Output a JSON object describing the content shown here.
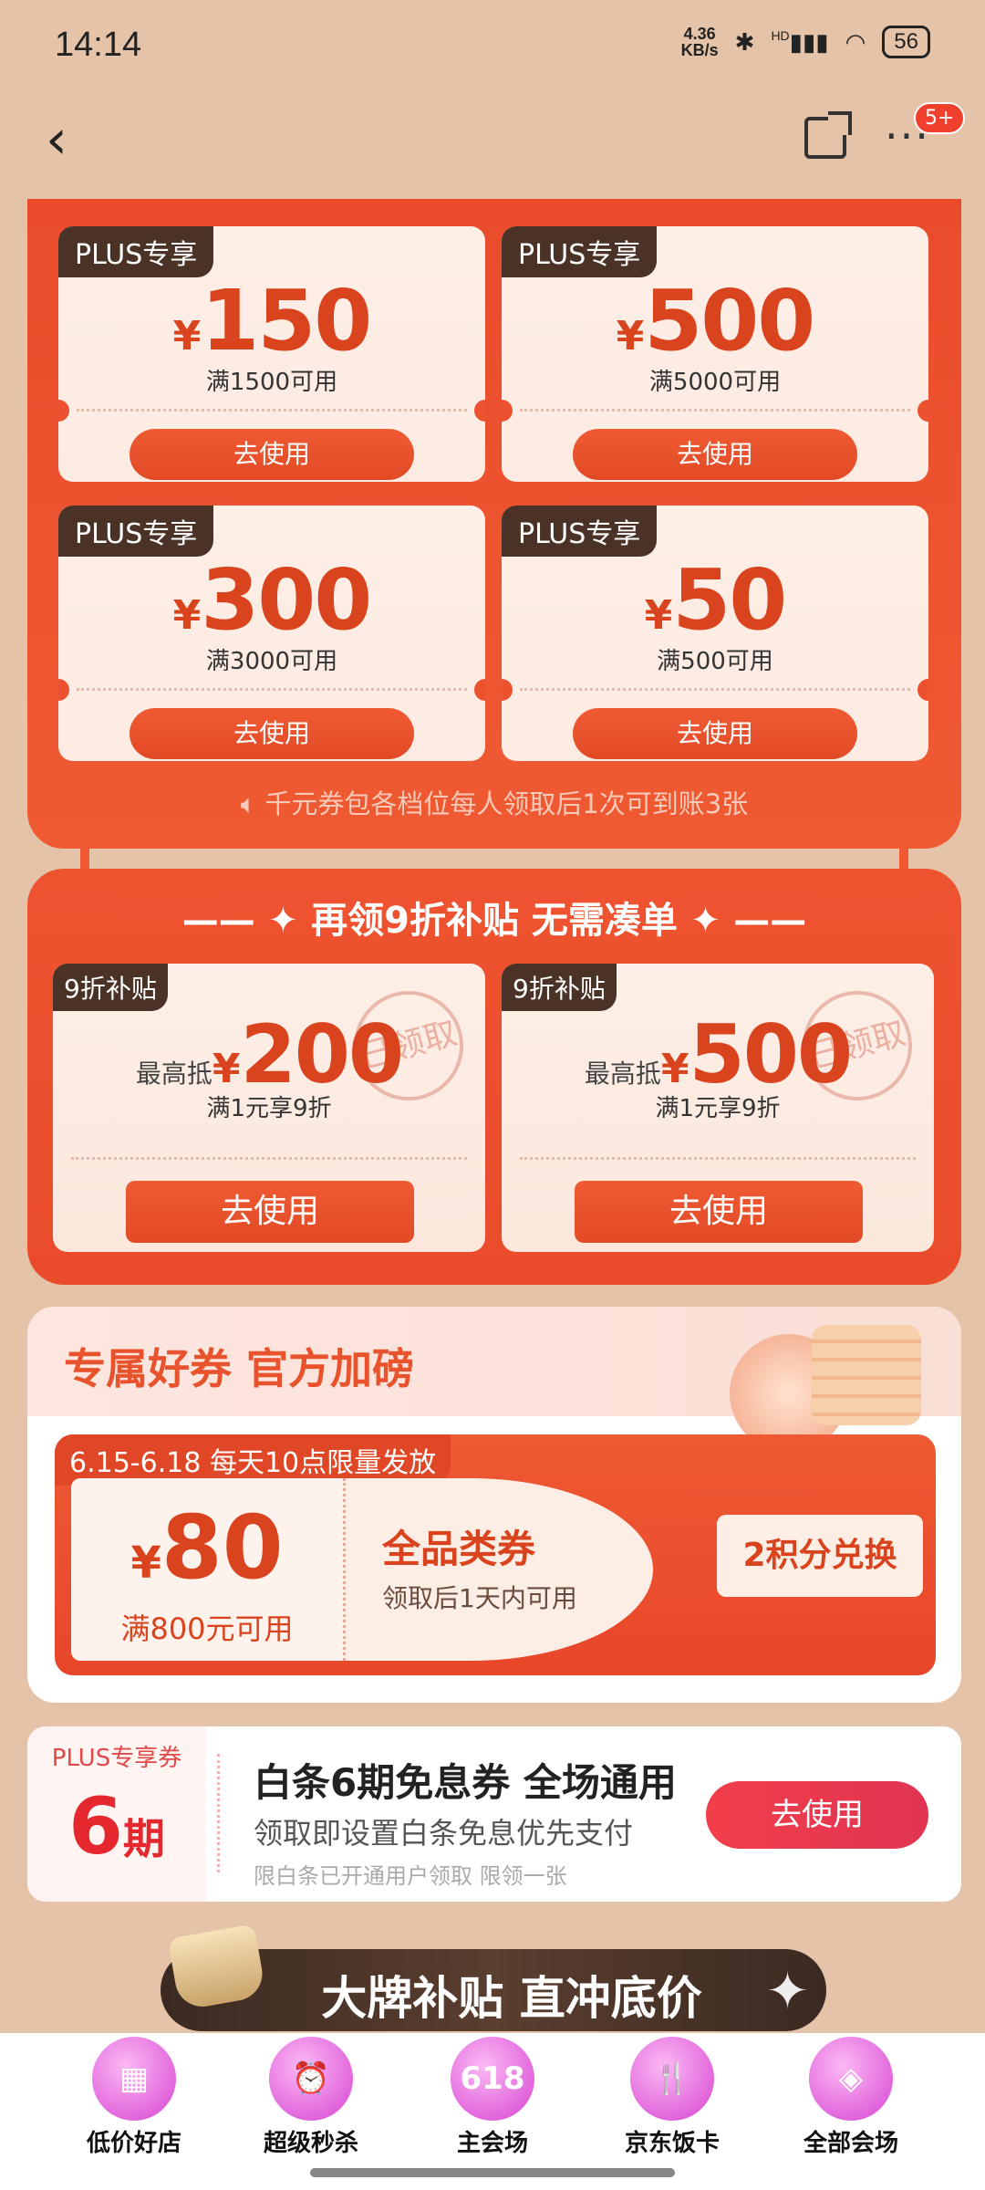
{
  "status_bar": {
    "time": "14:14",
    "net_speed_value": "4.36",
    "net_speed_unit": "KB/s",
    "signal": "HD",
    "battery": "56"
  },
  "nav": {
    "badge": "5+"
  },
  "plus_coupons": [
    {
      "tag": "PLUS专享",
      "yen": "¥",
      "amount": "150",
      "condition": "满1500可用",
      "button": "去使用"
    },
    {
      "tag": "PLUS专享",
      "yen": "¥",
      "amount": "500",
      "condition": "满5000可用",
      "button": "去使用"
    },
    {
      "tag": "PLUS专享",
      "yen": "¥",
      "amount": "300",
      "condition": "满3000可用",
      "button": "去使用"
    },
    {
      "tag": "PLUS专享",
      "yen": "¥",
      "amount": "50",
      "condition": "满500可用",
      "button": "去使用"
    }
  ],
  "plus_notice": "千元券包各档位每人领取后1次可到账3张",
  "fold_section": {
    "title": "再领9折补贴 无需凑单",
    "coupons": [
      {
        "tag": "9折补贴",
        "prefix": "最高抵",
        "yen": "¥",
        "amount": "200",
        "condition": "满1元享9折",
        "stamp": "已领取",
        "button": "去使用"
      },
      {
        "tag": "9折补贴",
        "prefix": "最高抵",
        "yen": "¥",
        "amount": "500",
        "condition": "满1元享9折",
        "stamp": "已领取",
        "button": "去使用"
      }
    ]
  },
  "exclusive": {
    "title": "专属好券 官方加磅",
    "date_tag": "6.15-6.18 每天10点限量发放",
    "yen": "¥",
    "amount": "80",
    "condition": "满800元可用",
    "coupon_title": "全品类券",
    "coupon_sub": "领取后1天内可用",
    "redeem_button": "2积分兑换"
  },
  "baitiao": {
    "tag": "PLUS专享券",
    "period_num": "6",
    "period_unit": "期",
    "title": "白条6期免息券 全场通用",
    "subtitle": "领取即设置白条免息优先支付",
    "note": "限白条已开通用户领取 限领一张",
    "button": "去使用"
  },
  "brand_banner": "大牌补贴 直冲底价",
  "bottom_nav": [
    {
      "label": "低价好店",
      "icon": "store-icon",
      "glyph": "▦"
    },
    {
      "label": "超级秒杀",
      "icon": "alarm-clock-icon",
      "glyph": "⏰"
    },
    {
      "label": "主会场",
      "icon": "618-icon",
      "glyph": "618"
    },
    {
      "label": "京东饭卡",
      "icon": "fork-knife-icon",
      "glyph": "🍴"
    },
    {
      "label": "全部会场",
      "icon": "grid-icon",
      "glyph": "◈"
    }
  ],
  "colors": {
    "accent": "#ea4c2b",
    "background": "#e4c3a8",
    "dark_tag": "#4a3326"
  }
}
